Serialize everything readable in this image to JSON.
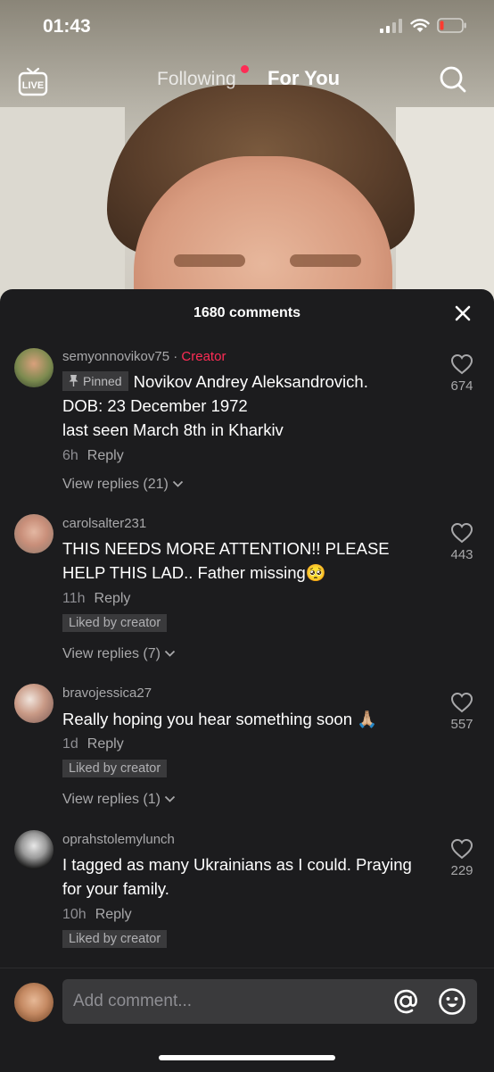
{
  "status_bar": {
    "time": "01:43"
  },
  "top_nav": {
    "live_icon": "live-tv-icon",
    "tabs": [
      {
        "label": "Following"
      },
      {
        "label": "For You"
      }
    ],
    "search_icon": "search-icon"
  },
  "colors": {
    "accent": "#fe2c55",
    "sheet_bg": "#1c1c1e",
    "chip_bg": "#3a3a3c"
  },
  "comments_sheet": {
    "count_label": "1680 comments",
    "close_icon": "close-icon",
    "comments": [
      {
        "username": "semyonnovikov75",
        "separator": " · ",
        "creator_tag": "Creator",
        "pinned_label": "Pinned",
        "text_line1": "Novikov Andrey Aleksandrovich.",
        "text_line2": "DOB: 23 December 1972",
        "text_line3": "last seen March 8th in Kharkiv",
        "time": "6h",
        "reply_label": "Reply",
        "view_replies": "View replies (21)",
        "likes": "674"
      },
      {
        "username": "carolsalter231",
        "text_line1": "THIS NEEDS MORE ATTENTION!! PLEASE",
        "text_line2": "HELP THIS LAD.. Father missing🥺",
        "time": "11h",
        "reply_label": "Reply",
        "liked_by": "Liked by creator",
        "view_replies": "View replies (7)",
        "likes": "443"
      },
      {
        "username": "bravojessica27",
        "text_line1": "Really hoping you hear something soon 🙏🏼",
        "time": "1d",
        "reply_label": "Reply",
        "liked_by": "Liked by creator",
        "view_replies": "View replies (1)",
        "likes": "557"
      },
      {
        "username": "oprahstolemylunch",
        "text_line1": "I tagged as many Ukrainians as I could. Praying",
        "text_line2": "for your family.",
        "time": "10h",
        "reply_label": "Reply",
        "liked_by": "Liked by creator",
        "likes": "229"
      }
    ]
  },
  "composer": {
    "placeholder": "Add comment...",
    "mention_icon": "at-icon",
    "emoji_icon": "emoji-icon"
  }
}
